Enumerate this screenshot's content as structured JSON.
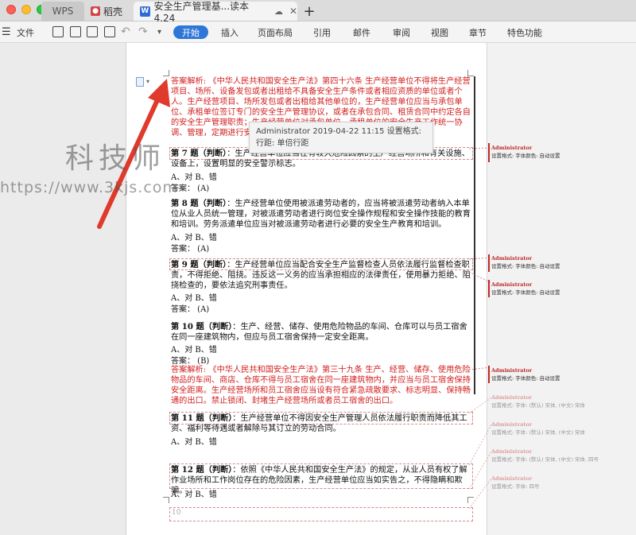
{
  "tabs": {
    "wps": "WPS",
    "daoke": "稻壳",
    "doc": "安全生产管理基...读本 4.24",
    "add": "+"
  },
  "toolbar": {
    "file": "文件",
    "start": "开始",
    "menus": [
      "插入",
      "页面布局",
      "引用",
      "邮件",
      "审阅",
      "视图",
      "章节",
      "特色功能"
    ]
  },
  "tooltip": {
    "line1": "Administrator 2019-04-22 11:15 设置格式:",
    "line2": "行距: 单倍行距"
  },
  "watermark": {
    "title": "科技师",
    "url": "https://www.3kjs.com"
  },
  "doc": {
    "p0": "答案解析: 《中华人民共和国安全生产法》第四十六条   生产经营单位不得将生产经营项目、场所、设备发包或者出租给不具备安全生产条件或者相应资质的单位或者个人。生产经营项目、场所发包或者出租给其他单位的，生产经营单位应当与承包单位、承租单位签订专门的安全生产管理协议，或者在承包合同、租赁合同中约定各自的安全生产管理职责；生产经营单位对承包单位、承租单位的安全生产工作统一协调、管理，定期进行安全检查，发现安全问题的，应当及时督促整改。",
    "q7_title": "第 7 题（判断）",
    "q7_body": "：生产经营单位应当在有较大危险因素的生产经营场所和有关设施、设备上，设置明显的安全警示标志。",
    "q7_opts": "A、对              B、错",
    "q7_ans": "答案：  (A)",
    "q8_title": "第 8 题（判断）",
    "q8_body": "：生产经营单位使用被派遣劳动者的，应当将被派遣劳动者纳入本单位从业人员统一管理，对被派遣劳动者进行岗位安全操作规程和安全操作技能的教育和培训。劳务派遣单位应当对被派遣劳动者进行必要的安全生产教育和培训。",
    "q8_opts": "A、对              B、错",
    "q8_ans": "答案：  (A)",
    "q9_title": "第 9 题（判断）",
    "q9_body": "：生产经营单位应当配合安全生产监督检查人员依法履行监督检查职责，不得拒绝、阻挠。违反这一义务的应当承担相应的法律责任，使用暴力拒绝、阻挠检查的，要依法追究刑事责任。",
    "q9_opts": "A、对              B、错",
    "q9_ans": "答案：  (A)",
    "q10_title": "第 10 题（判断）",
    "q10_body": "：生产、经营、储存、使用危险物品的车间、仓库可以与员工宿舍在同一座建筑物内，但应与员工宿舍保持一定安全距离。",
    "q10_opts": "A、对              B、错",
    "q10_ans": "答案：  (B)",
    "p10_exp": "答案解析: 《中华人民共和国安全生产法》第三十九条   生产、经营、储存、使用危险物品的车间、商店、仓库不得与员工宿舍在同一座建筑物内，并应当与员工宿舍保持安全距离。生产经营场所和员工宿舍应当设有符合紧急疏散要求、标志明显、保持畅通的出口。禁止锁闭、封堵生产经营场所或者员工宿舍的出口。",
    "q11_title": "第 11 题（判断）",
    "q11_body": "：生产经营单位不得因安全生产管理人员依法履行职责而降低其工资、福利等待遇或者解除与其订立的劳动合同。",
    "q11_opts": "A、对              B、错",
    "q12_title": "第 12 题（判断）",
    "q12_body": "：依照《中华人民共和国安全生产法》的规定，从业人员有权了解作业场所和工作岗位存在的危险因素，生产经营单位应当如实告之，不得隐瞒和欺骗。",
    "q12_opts": "A、对              B、错",
    "page_num": "10"
  },
  "comments": [
    {
      "author": "Administrator",
      "text": "设置格式: 字体颜色: 自动设置"
    },
    {
      "author": "Administrator",
      "text": "设置格式: 字体颜色: 自动设置"
    },
    {
      "author": "Administrator",
      "text": "设置格式: 字体颜色: 自动设置"
    },
    {
      "author": "Administrator",
      "text": "设置格式: 字体颜色: 自动设置"
    },
    {
      "author": "Administrator",
      "text": "设置格式: 字体: (默认) 宋体, (中文) 宋体"
    },
    {
      "author": "Administrator",
      "text": "设置格式: 字体: (默认) 宋体, (中文) 宋体"
    },
    {
      "author": "Administrator",
      "text": "设置格式: 字体: (默认) 宋体, (中文) 宋体, 四号"
    },
    {
      "author": "Administrator",
      "text": "设置格式: 字体: 四号"
    }
  ]
}
